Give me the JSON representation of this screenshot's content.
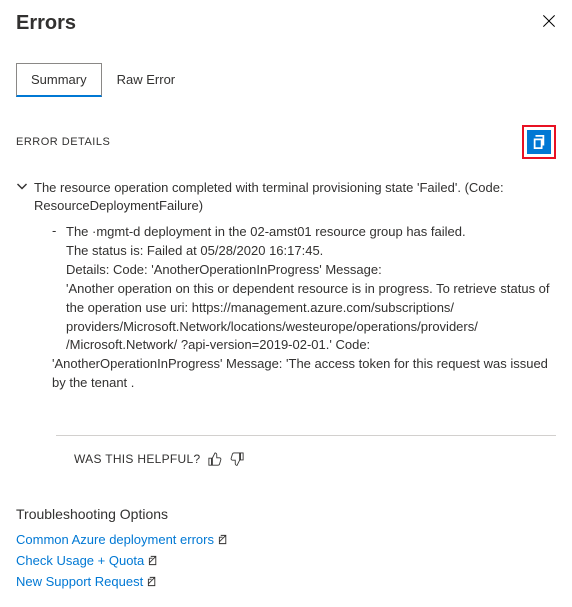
{
  "header": {
    "title": "Errors"
  },
  "tabs": [
    {
      "label": "Summary",
      "active": true
    },
    {
      "label": "Raw Error",
      "active": false
    }
  ],
  "section_label": "ERROR DETAILS",
  "error": {
    "main_message": "The resource operation completed with terminal provisioning state 'Failed'. (Code: ResourceDeploymentFailure)",
    "detail_lines": [
      "The   ·mgmt-d deployment in the 02-amst01 resource group has failed.",
      "The status is: Failed at  05/28/2020 16:17:45.",
      "Details: Code: 'AnotherOperationInProgress' Message:",
      "'Another operation on this or dependent resource is in progress. To retrieve status of the operation use uri:  https://management.azure.com/subscriptions/  providers/Microsoft.Network/locations/westeurope/operations/providers/  /Microsoft.Network/ ?api-version=2019-02-01.' Code:",
      "  'AnotherOperationInProgress'     Message: 'The access token for this request was issued by the tenant ."
    ]
  },
  "helpful_label": "WAS THIS HELPFUL?",
  "troubleshoot": {
    "title": "Troubleshooting Options",
    "links": [
      "Common Azure deployment errors",
      "Check Usage + Quota",
      "New Support Request"
    ]
  }
}
